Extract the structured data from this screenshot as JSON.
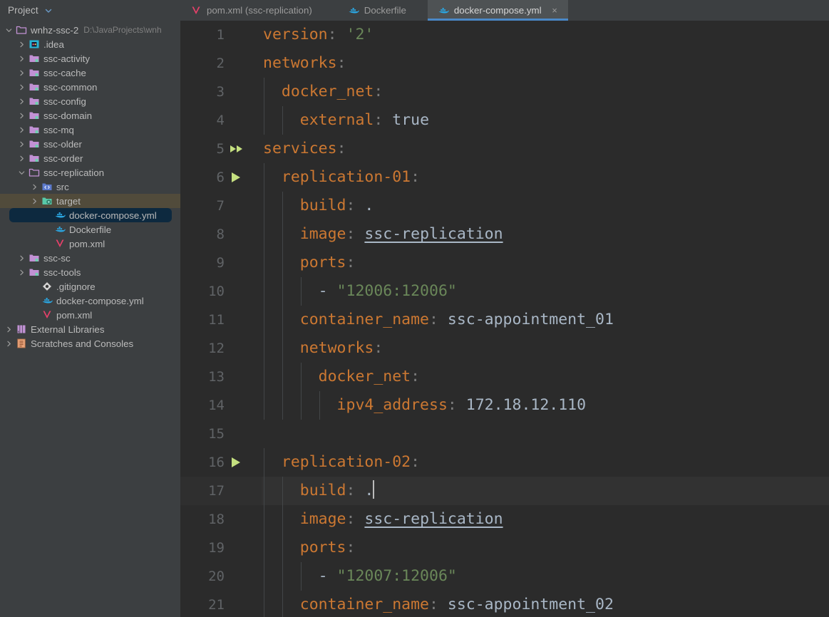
{
  "sidebar": {
    "header": {
      "title": "Project",
      "collapse_icon": "chevron-down-icon"
    },
    "items": [
      {
        "label": "wnhz-ssc-2",
        "path": "D:\\JavaProjects\\wnh",
        "icon": "folder-open-icon",
        "arrow": "down",
        "indent": 0,
        "state": "normal"
      },
      {
        "label": ".idea",
        "path": "",
        "icon": "idea-folder-icon",
        "arrow": "right",
        "indent": 1,
        "state": "normal"
      },
      {
        "label": "ssc-activity",
        "path": "",
        "icon": "module-folder-icon",
        "arrow": "right",
        "indent": 1,
        "state": "normal"
      },
      {
        "label": "ssc-cache",
        "path": "",
        "icon": "module-folder-icon",
        "arrow": "right",
        "indent": 1,
        "state": "normal"
      },
      {
        "label": "ssc-common",
        "path": "",
        "icon": "module-folder-icon",
        "arrow": "right",
        "indent": 1,
        "state": "normal"
      },
      {
        "label": "ssc-config",
        "path": "",
        "icon": "module-folder-icon",
        "arrow": "right",
        "indent": 1,
        "state": "normal"
      },
      {
        "label": "ssc-domain",
        "path": "",
        "icon": "module-folder-icon",
        "arrow": "right",
        "indent": 1,
        "state": "normal"
      },
      {
        "label": "ssc-mq",
        "path": "",
        "icon": "module-folder-icon",
        "arrow": "right",
        "indent": 1,
        "state": "normal"
      },
      {
        "label": "ssc-older",
        "path": "",
        "icon": "module-folder-icon",
        "arrow": "right",
        "indent": 1,
        "state": "normal"
      },
      {
        "label": "ssc-order",
        "path": "",
        "icon": "module-folder-icon",
        "arrow": "right",
        "indent": 1,
        "state": "normal"
      },
      {
        "label": "ssc-replication",
        "path": "",
        "icon": "folder-open-icon",
        "arrow": "down",
        "indent": 1,
        "state": "normal"
      },
      {
        "label": "src",
        "path": "",
        "icon": "source-folder-icon",
        "arrow": "right",
        "indent": 2,
        "state": "normal"
      },
      {
        "label": "target",
        "path": "",
        "icon": "target-folder-icon",
        "arrow": "right",
        "indent": 2,
        "state": "highlighted"
      },
      {
        "label": "docker-compose.yml",
        "path": "",
        "icon": "docker-icon",
        "arrow": "none",
        "indent": 3,
        "state": "selected"
      },
      {
        "label": "Dockerfile",
        "path": "",
        "icon": "docker-icon",
        "arrow": "none",
        "indent": 3,
        "state": "normal"
      },
      {
        "label": "pom.xml",
        "path": "",
        "icon": "maven-icon",
        "arrow": "none",
        "indent": 3,
        "state": "normal"
      },
      {
        "label": "ssc-sc",
        "path": "",
        "icon": "module-folder-icon",
        "arrow": "right",
        "indent": 1,
        "state": "normal"
      },
      {
        "label": "ssc-tools",
        "path": "",
        "icon": "module-folder-icon",
        "arrow": "right",
        "indent": 1,
        "state": "normal"
      },
      {
        "label": ".gitignore",
        "path": "",
        "icon": "git-icon",
        "arrow": "none",
        "indent": 2,
        "state": "normal"
      },
      {
        "label": "docker-compose.yml",
        "path": "",
        "icon": "docker-icon",
        "arrow": "none",
        "indent": 2,
        "state": "normal"
      },
      {
        "label": "pom.xml",
        "path": "",
        "icon": "maven-icon",
        "arrow": "none",
        "indent": 2,
        "state": "normal"
      },
      {
        "label": "External Libraries",
        "path": "",
        "icon": "library-icon",
        "arrow": "right",
        "indent": 0,
        "state": "normal"
      },
      {
        "label": "Scratches and Consoles",
        "path": "",
        "icon": "scratches-icon",
        "arrow": "right",
        "indent": 0,
        "state": "normal"
      }
    ]
  },
  "tabs": [
    {
      "label": "pom.xml (ssc-replication)",
      "icon": "maven-icon",
      "active": false,
      "closable": false
    },
    {
      "label": "Dockerfile",
      "icon": "docker-icon",
      "active": false,
      "closable": false
    },
    {
      "label": "docker-compose.yml",
      "icon": "docker-icon",
      "active": true,
      "closable": true,
      "close_label": "×"
    }
  ],
  "editor": {
    "filename": "docker-compose.yml",
    "current_line": 17,
    "lines": [
      {
        "n": "1",
        "run": "none",
        "indent": 0,
        "tokens": [
          {
            "t": "version",
            "c": "k"
          },
          {
            "t": ":",
            "c": "p"
          },
          {
            "t": " ",
            "c": "v"
          },
          {
            "t": "'2'",
            "c": "s"
          }
        ]
      },
      {
        "n": "2",
        "run": "none",
        "indent": 0,
        "tokens": [
          {
            "t": "networks",
            "c": "k"
          },
          {
            "t": ":",
            "c": "p"
          }
        ]
      },
      {
        "n": "3",
        "run": "none",
        "indent": 1,
        "tokens": [
          {
            "t": "  docker_net",
            "c": "k"
          },
          {
            "t": ":",
            "c": "p"
          }
        ]
      },
      {
        "n": "4",
        "run": "none",
        "indent": 2,
        "tokens": [
          {
            "t": "    external",
            "c": "k"
          },
          {
            "t": ":",
            "c": "p"
          },
          {
            "t": " ",
            "c": "v"
          },
          {
            "t": "true",
            "c": "v"
          }
        ]
      },
      {
        "n": "5",
        "run": "double",
        "indent": 0,
        "tokens": [
          {
            "t": "services",
            "c": "k"
          },
          {
            "t": ":",
            "c": "p"
          }
        ]
      },
      {
        "n": "6",
        "run": "single",
        "indent": 1,
        "tokens": [
          {
            "t": "  replication-01",
            "c": "k"
          },
          {
            "t": ":",
            "c": "p"
          }
        ]
      },
      {
        "n": "7",
        "run": "none",
        "indent": 2,
        "tokens": [
          {
            "t": "    build",
            "c": "k"
          },
          {
            "t": ":",
            "c": "p"
          },
          {
            "t": " .",
            "c": "v"
          }
        ]
      },
      {
        "n": "8",
        "run": "none",
        "indent": 2,
        "tokens": [
          {
            "t": "    image",
            "c": "k"
          },
          {
            "t": ":",
            "c": "p"
          },
          {
            "t": " ",
            "c": "v"
          },
          {
            "t": "ssc-replication",
            "c": "u"
          }
        ]
      },
      {
        "n": "9",
        "run": "none",
        "indent": 2,
        "tokens": [
          {
            "t": "    ports",
            "c": "k"
          },
          {
            "t": ":",
            "c": "p"
          }
        ]
      },
      {
        "n": "10",
        "run": "none",
        "indent": 3,
        "tokens": [
          {
            "t": "      - ",
            "c": "d"
          },
          {
            "t": "\"12006:12006\"",
            "c": "s"
          }
        ]
      },
      {
        "n": "11",
        "run": "none",
        "indent": 2,
        "tokens": [
          {
            "t": "    container_name",
            "c": "k"
          },
          {
            "t": ":",
            "c": "p"
          },
          {
            "t": " ssc-appointment_01",
            "c": "v"
          }
        ]
      },
      {
        "n": "12",
        "run": "none",
        "indent": 2,
        "tokens": [
          {
            "t": "    networks",
            "c": "k"
          },
          {
            "t": ":",
            "c": "p"
          }
        ]
      },
      {
        "n": "13",
        "run": "none",
        "indent": 3,
        "tokens": [
          {
            "t": "      docker_net",
            "c": "k"
          },
          {
            "t": ":",
            "c": "p"
          }
        ]
      },
      {
        "n": "14",
        "run": "none",
        "indent": 4,
        "tokens": [
          {
            "t": "        ipv4_address",
            "c": "k"
          },
          {
            "t": ":",
            "c": "p"
          },
          {
            "t": " 172.18.12.110",
            "c": "v"
          }
        ]
      },
      {
        "n": "15",
        "run": "none",
        "indent": 0,
        "tokens": []
      },
      {
        "n": "16",
        "run": "single",
        "indent": 1,
        "tokens": [
          {
            "t": "  replication-02",
            "c": "k"
          },
          {
            "t": ":",
            "c": "p"
          }
        ]
      },
      {
        "n": "17",
        "run": "none",
        "indent": 2,
        "tokens": [
          {
            "t": "    build",
            "c": "k"
          },
          {
            "t": ":",
            "c": "p"
          },
          {
            "t": " .",
            "c": "v"
          }
        ],
        "caret": true
      },
      {
        "n": "18",
        "run": "none",
        "indent": 2,
        "tokens": [
          {
            "t": "    image",
            "c": "k"
          },
          {
            "t": ":",
            "c": "p"
          },
          {
            "t": " ",
            "c": "v"
          },
          {
            "t": "ssc-replication",
            "c": "u"
          }
        ]
      },
      {
        "n": "19",
        "run": "none",
        "indent": 2,
        "tokens": [
          {
            "t": "    ports",
            "c": "k"
          },
          {
            "t": ":",
            "c": "p"
          }
        ]
      },
      {
        "n": "20",
        "run": "none",
        "indent": 3,
        "tokens": [
          {
            "t": "      - ",
            "c": "d"
          },
          {
            "t": "\"12007:12006\"",
            "c": "s"
          }
        ]
      },
      {
        "n": "21",
        "run": "none",
        "indent": 2,
        "tokens": [
          {
            "t": "    container_name",
            "c": "k"
          },
          {
            "t": ":",
            "c": "p"
          },
          {
            "t": " ssc-appointment_02",
            "c": "v"
          }
        ]
      }
    ]
  },
  "colors": {
    "sidebar_bg": "#3C3F41",
    "editor_bg": "#2B2B2B",
    "selection_bg": "#0D293F",
    "highlight_bg": "#514B3B",
    "tab_active_bg": "#4E5254",
    "tab_underline": "#4A88C7",
    "key": "#CC7832",
    "string": "#6A8759",
    "value": "#A9B7C6",
    "line_number": "#606366",
    "run_icon": "#C5E080",
    "current_line_bg": "#323232"
  }
}
